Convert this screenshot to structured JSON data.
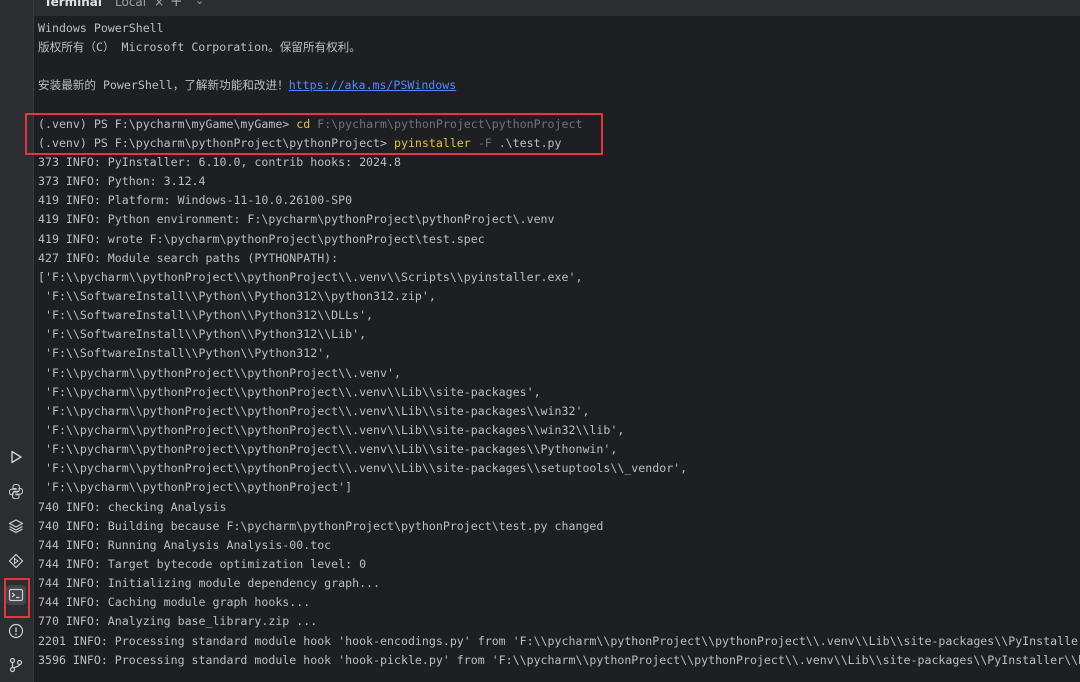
{
  "tabs": {
    "panel_title": "Terminal",
    "local_tab": "Local",
    "close_glyph": "×",
    "add_glyph": "+",
    "dropdown_glyph": "⌄"
  },
  "terminal": {
    "l1": "Windows PowerShell",
    "l2": "版权所有（C） Microsoft Corporation。保留所有权利。",
    "l3": "",
    "l4_prefix": "安装最新的 PowerShell，了解新功能和改进！",
    "l4_link": "https://aka.ms/PSWindows",
    "l5": "",
    "cmd1_prompt": "(.venv) PS F:\\pycharm\\myGame\\myGame> ",
    "cmd1_name": "cd",
    "cmd1_arg": " F:\\pycharm\\pythonProject\\pythonProject",
    "cmd2_prompt": "(.venv) PS F:\\pycharm\\pythonProject\\pythonProject> ",
    "cmd2_name": "pyinstaller",
    "cmd2_flag": " -F",
    "cmd2_arg": " .\\test.py",
    "output": [
      "373 INFO: PyInstaller: 6.10.0, contrib hooks: 2024.8",
      "373 INFO: Python: 3.12.4",
      "419 INFO: Platform: Windows-11-10.0.26100-SP0",
      "419 INFO: Python environment: F:\\pycharm\\pythonProject\\pythonProject\\.venv",
      "419 INFO: wrote F:\\pycharm\\pythonProject\\pythonProject\\test.spec",
      "427 INFO: Module search paths (PYTHONPATH):",
      "['F:\\\\pycharm\\\\pythonProject\\\\pythonProject\\\\.venv\\\\Scripts\\\\pyinstaller.exe',",
      " 'F:\\\\SoftwareInstall\\\\Python\\\\Python312\\\\python312.zip',",
      " 'F:\\\\SoftwareInstall\\\\Python\\\\Python312\\\\DLLs',",
      " 'F:\\\\SoftwareInstall\\\\Python\\\\Python312\\\\Lib',",
      " 'F:\\\\SoftwareInstall\\\\Python\\\\Python312',",
      " 'F:\\\\pycharm\\\\pythonProject\\\\pythonProject\\\\.venv',",
      " 'F:\\\\pycharm\\\\pythonProject\\\\pythonProject\\\\.venv\\\\Lib\\\\site-packages',",
      " 'F:\\\\pycharm\\\\pythonProject\\\\pythonProject\\\\.venv\\\\Lib\\\\site-packages\\\\win32',",
      " 'F:\\\\pycharm\\\\pythonProject\\\\pythonProject\\\\.venv\\\\Lib\\\\site-packages\\\\win32\\\\lib',",
      " 'F:\\\\pycharm\\\\pythonProject\\\\pythonProject\\\\.venv\\\\Lib\\\\site-packages\\\\Pythonwin',",
      " 'F:\\\\pycharm\\\\pythonProject\\\\pythonProject\\\\.venv\\\\Lib\\\\site-packages\\\\setuptools\\\\_vendor',",
      " 'F:\\\\pycharm\\\\pythonProject\\\\pythonProject']",
      "740 INFO: checking Analysis",
      "740 INFO: Building because F:\\pycharm\\pythonProject\\pythonProject\\test.py changed",
      "744 INFO: Running Analysis Analysis-00.toc",
      "744 INFO: Target bytecode optimization level: 0",
      "744 INFO: Initializing module dependency graph...",
      "744 INFO: Caching module graph hooks...",
      "770 INFO: Analyzing base_library.zip ...",
      "2201 INFO: Processing standard module hook 'hook-encodings.py' from 'F:\\\\pycharm\\\\pythonProject\\\\pythonProject\\\\.venv\\\\Lib\\\\site-packages\\\\PyInstaller",
      "3596 INFO: Processing standard module hook 'hook-pickle.py' from 'F:\\\\pycharm\\\\pythonProject\\\\pythonProject\\\\.venv\\\\Lib\\\\site-packages\\\\PyInstaller\\\\h"
    ]
  },
  "sidebar_icons": [
    "run-icon",
    "python-console-icon",
    "layers-icon",
    "services-icon",
    "terminal-icon",
    "problems-icon",
    "git-icon"
  ],
  "colors": {
    "background": "#1e1f22",
    "text": "#bcbec4",
    "command": "#e3c23c",
    "link": "#548af7",
    "highlight_box": "#e0383e"
  }
}
